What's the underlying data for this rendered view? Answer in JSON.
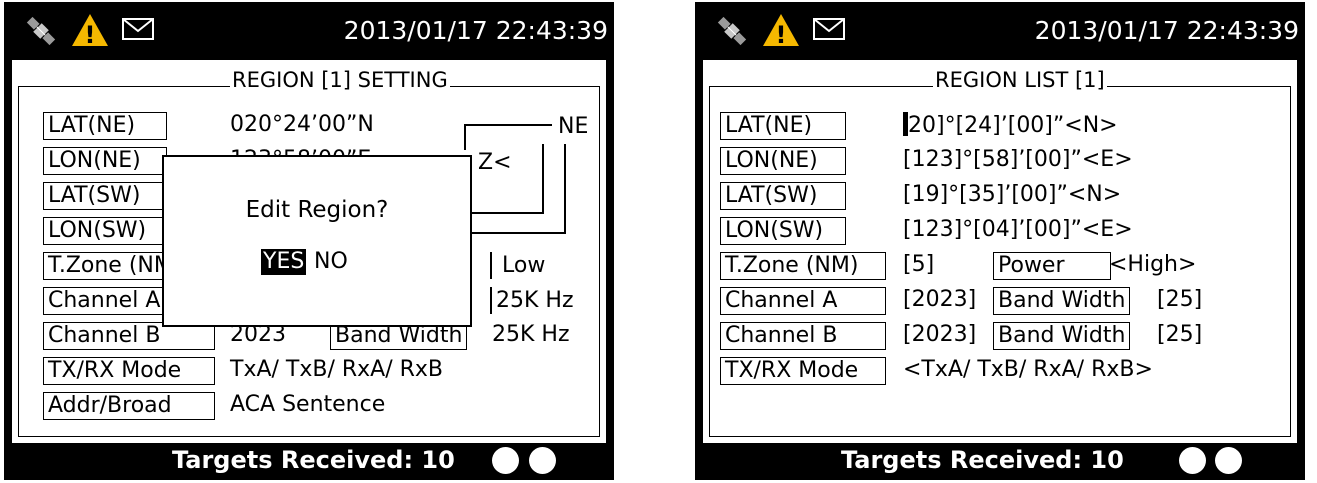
{
  "status_bar": {
    "datetime": "2013/01/17 22:43:39",
    "icons": [
      "satellite-icon",
      "warning-icon",
      "mail-icon"
    ],
    "warning_symbol": "!"
  },
  "left_screen": {
    "title": "REGION [1] SETTING",
    "rows": [
      {
        "label": "LAT(NE)",
        "value": "020°24’00”N"
      },
      {
        "label": "LON(NE)",
        "value": "123°58’00”E"
      },
      {
        "label": "LAT(SW)",
        "value": ""
      },
      {
        "label": "LON(SW)",
        "value": ""
      },
      {
        "label": "T.Zone (NM)",
        "value": ""
      },
      {
        "label": "Channel A",
        "value": ""
      },
      {
        "label": "Channel B",
        "value": "2023"
      },
      {
        "label": "TX/RX Mode",
        "value": "TxA/ TxB/ RxA/ RxB"
      },
      {
        "label": "Addr/Broad",
        "value": "ACA Sentence"
      }
    ],
    "ne_label": "NE",
    "partial_marker": "Z<",
    "power_value": "Low",
    "bandwidth_a_value": "25K Hz",
    "bandwidth_label": "Band Width",
    "bandwidth_b_value": "25K Hz",
    "dialog": {
      "title": "Edit Region?",
      "yes": "YES",
      "no": "NO"
    }
  },
  "right_screen": {
    "title": "REGION LIST [1]",
    "rows": [
      {
        "label": "LAT(NE)",
        "value": "20]°[24]’[00]”<N>"
      },
      {
        "label": "LON(NE)",
        "value": "[123]°[58]’[00]”<E>"
      },
      {
        "label": "LAT(SW)",
        "value": "[19]°[35]’[00]”<N>"
      },
      {
        "label": "LON(SW)",
        "value": "[123]°[04]’[00]”<E>"
      },
      {
        "label": "T.Zone (NM)",
        "value": "[5]"
      },
      {
        "label": "Channel A",
        "value": "[2023]"
      },
      {
        "label": "Channel B",
        "value": "[2023]"
      },
      {
        "label": "TX/RX Mode",
        "value": "<TxA/ TxB/ RxA/ RxB>"
      }
    ],
    "power_label": "Power",
    "power_value": "<High>",
    "bandwidth_label": "Band Width",
    "bandwidth_a_value": "[25]",
    "bandwidth_b_value": "[25]"
  },
  "footer": {
    "targets_text": "Targets Received: 10"
  },
  "colors": {
    "screen_bg": "#000000",
    "panel_bg": "#ffffff",
    "warning": "#f5b800",
    "satellite_gray": "#9a9a9a"
  }
}
